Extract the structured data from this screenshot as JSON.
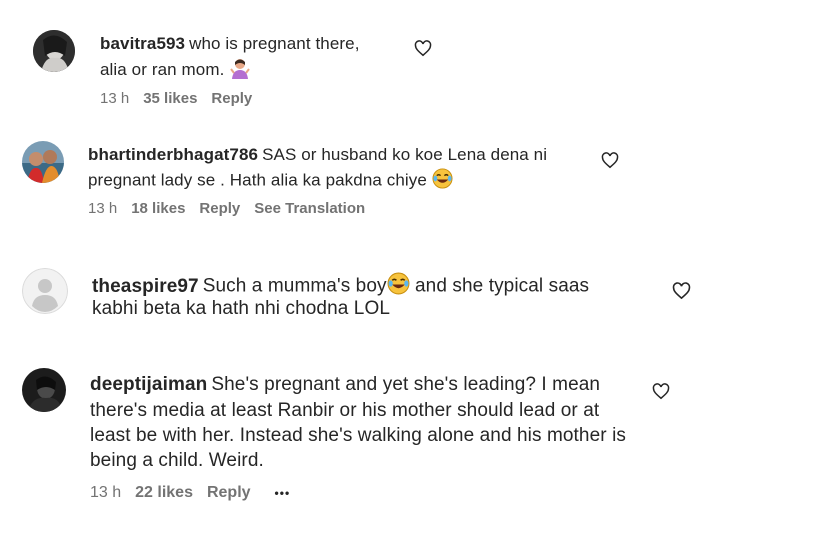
{
  "comments": [
    {
      "username": "bavitra593",
      "lines": [
        "who is pregnant there,",
        "alia or ran mom."
      ],
      "emoji": "woman-shrugging-icon",
      "time": "13 h",
      "likes": "35 likes",
      "reply": "Reply"
    },
    {
      "username": "bhartinderbhagat786",
      "lines": [
        "SAS or husband ko koe Lena dena ni",
        "pregnant lady se . Hath alia ka pakdna chiye"
      ],
      "emoji": "laughing-tears-icon",
      "time": "13 h",
      "likes": "18 likes",
      "reply": "Reply",
      "translate": "See Translation"
    },
    {
      "username": "theaspire97",
      "lines": [
        "Such a mumma's boy",
        "kabhi beta ka hath nhi chodna LOL"
      ],
      "line1_suffix": "and she typical saas",
      "emoji": "laughing-tears-icon"
    },
    {
      "username": "deeptijaiman",
      "lines": [
        "She's pregnant and yet she's leading? I mean",
        "there's media at least Ranbir or his mother should lead or at",
        "least be with her. Instead she's walking alone and his mother is",
        "being a child. Weird."
      ],
      "time": "13 h",
      "likes": "22 likes",
      "reply": "Reply",
      "more": "•••"
    }
  ],
  "colors": {
    "text": "#262626",
    "meta": "#737373",
    "background": "#ffffff"
  }
}
